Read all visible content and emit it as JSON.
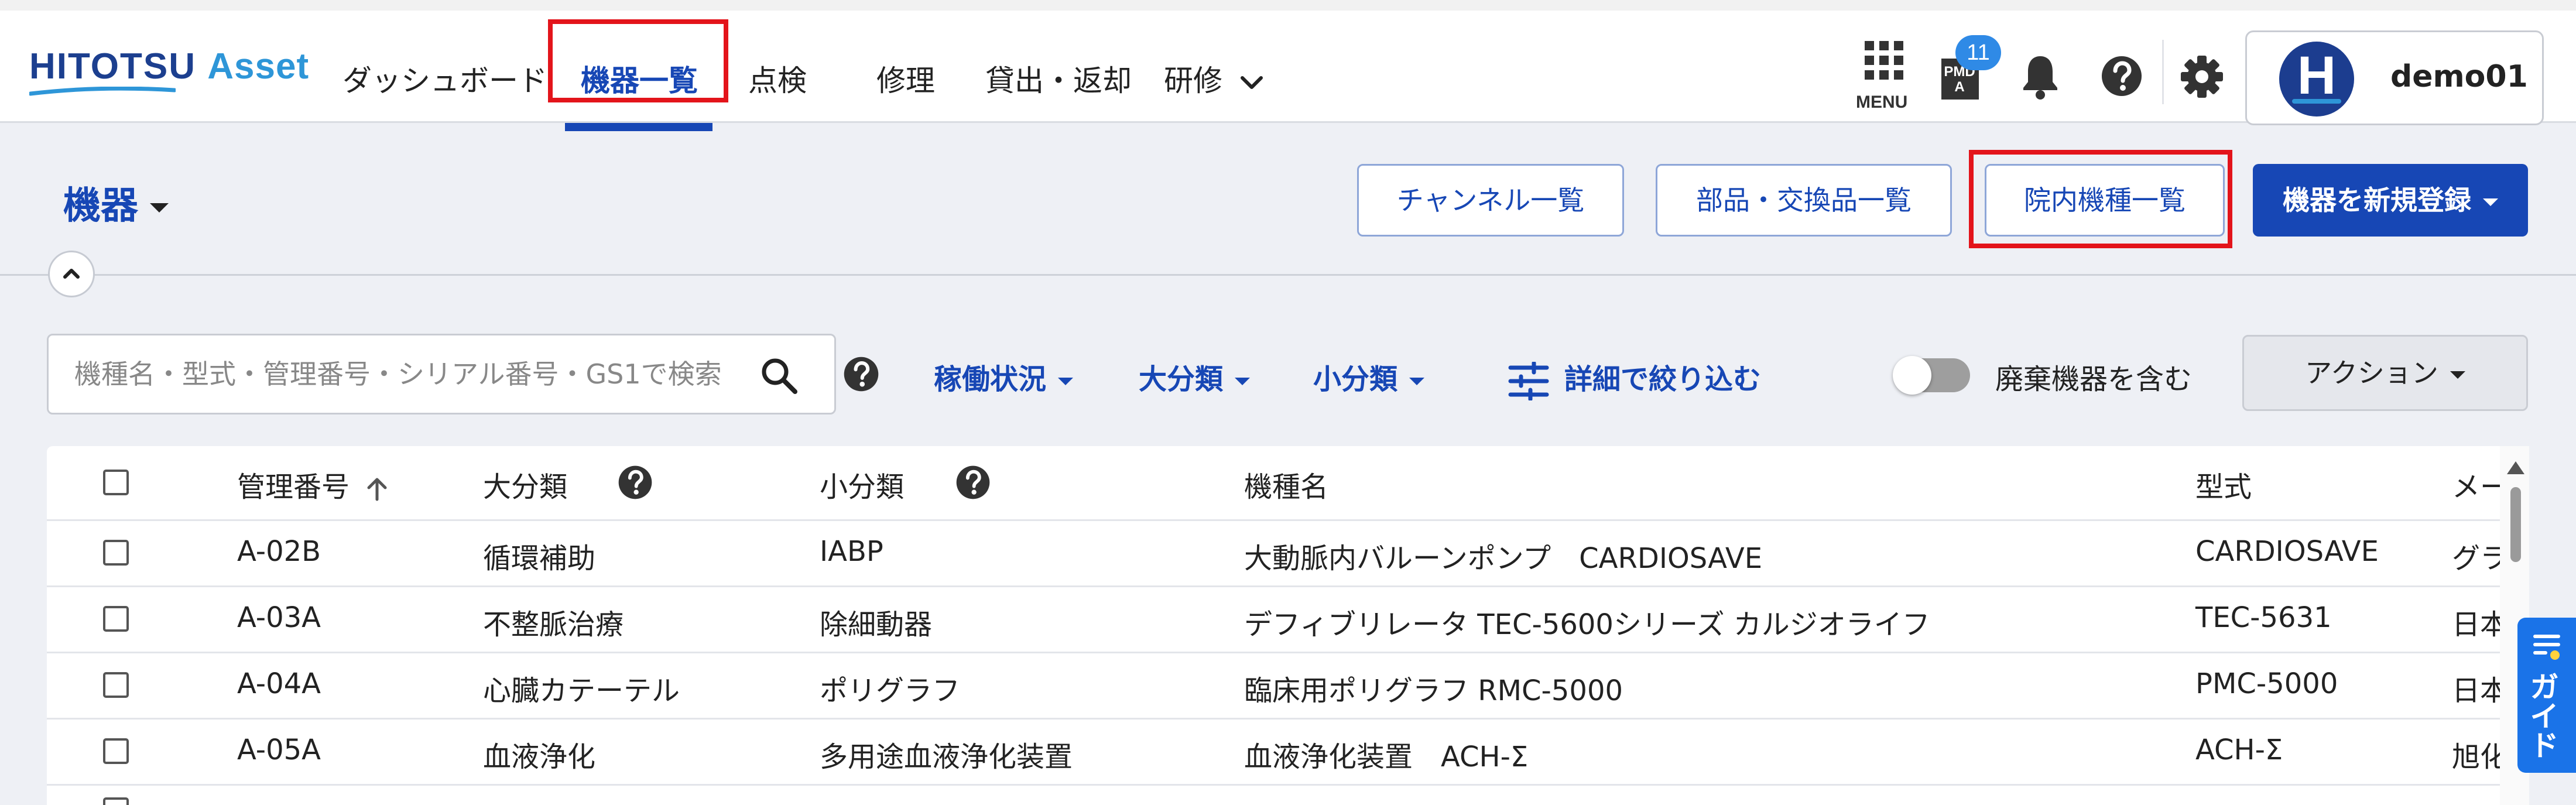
{
  "app": {
    "logo_main": "HITOTSU",
    "logo_accent": "Asset"
  },
  "nav": {
    "items": [
      {
        "label": "ダッシュボード"
      },
      {
        "label": "機器一覧"
      },
      {
        "label": "点検"
      },
      {
        "label": "修理"
      },
      {
        "label": "貸出・返却"
      },
      {
        "label": "研修"
      }
    ]
  },
  "header": {
    "menu_label": "MENU",
    "pmda_badge": "11",
    "pmda_icon_text": "PMDA",
    "user_initial": "H",
    "user_name": "demo01"
  },
  "page": {
    "title": "機器"
  },
  "toolbar": {
    "channel_list": "チャンネル一覧",
    "parts_list": "部品・交換品一覧",
    "inhouse_models": "院内機種一覧",
    "register": "機器を新規登録"
  },
  "filters": {
    "search_placeholder": "機種名・型式・管理番号・シリアル番号・GS1で検索",
    "operating_status": "稼働状況",
    "major_category": "大分類",
    "minor_category": "小分類",
    "advanced_filter": "詳細で絞り込む",
    "include_disposed": "廃棄機器を含む",
    "action": "アクション"
  },
  "table": {
    "columns": [
      "管理番号",
      "大分類",
      "小分類",
      "機種名",
      "型式",
      "メー"
    ],
    "rows": [
      {
        "id": "A-02B",
        "major": "循環補助",
        "minor": "IABP",
        "model_name": "大動脈内バルーンポンプ　CARDIOSAVE",
        "model": "CARDIOSAVE",
        "maker": "グラ"
      },
      {
        "id": "A-03A",
        "major": "不整脈治療",
        "minor": "除細動器",
        "model_name": "デフィブリレータ TEC-5600シリーズ カルジオライフ",
        "model": "TEC-5631",
        "maker": "日本"
      },
      {
        "id": "A-04A",
        "major": "心臓カテーテル",
        "minor": "ポリグラフ",
        "model_name": "臨床用ポリグラフ RMC-5000",
        "model": "PMC-5000",
        "maker": "日本"
      },
      {
        "id": "A-05A",
        "major": "血液浄化",
        "minor": "多用途血液浄化装置",
        "model_name": "血液浄化装置　ACH-Σ",
        "model": "ACH-Σ",
        "maker": "旭化"
      }
    ]
  },
  "guide": {
    "label": "ガイド"
  },
  "colors": {
    "primary": "#1747b5",
    "highlight": "#e3141b",
    "badge": "#2f8ae6"
  }
}
